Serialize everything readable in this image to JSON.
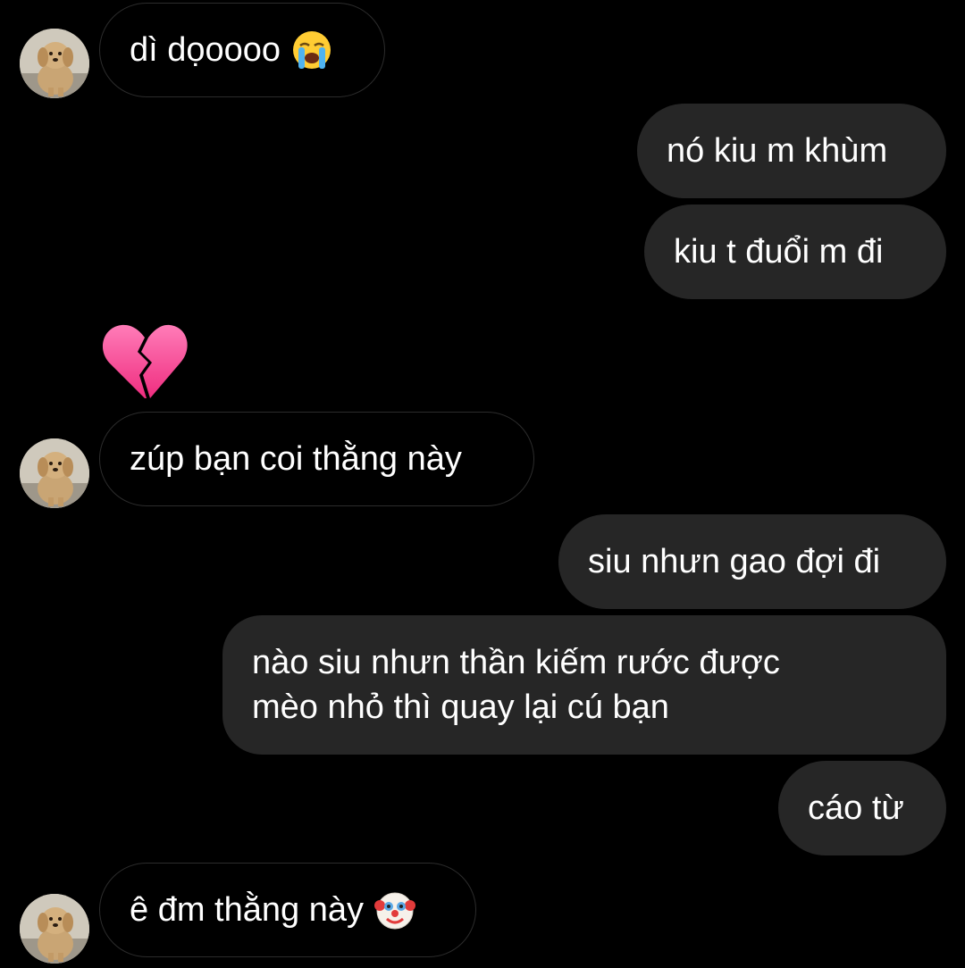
{
  "conversation": {
    "messages": [
      {
        "side": "in",
        "text": "dì dọoooo",
        "emoji": "loudly-crying-face"
      },
      {
        "side": "out",
        "text": "nó kiu m khùm"
      },
      {
        "side": "out",
        "text": "kiu t đuổi m đi"
      },
      {
        "side": "in",
        "text": "",
        "emoji": "broken-heart"
      },
      {
        "side": "in",
        "text": "zúp bạn coi thằng này"
      },
      {
        "side": "out",
        "text": "siu nhưn gao đợi đi"
      },
      {
        "side": "out",
        "text": "nào siu nhưn thần kiếm rước được\nmèo nhỏ thì quay lại cú bạn"
      },
      {
        "side": "out",
        "text": "cáo từ"
      },
      {
        "side": "in",
        "text": "ê đm thằng này",
        "emoji": "clown-face"
      }
    ]
  },
  "colors": {
    "background": "#000000",
    "outgoing_bubble": "#262626",
    "incoming_border": "#2c2c2c",
    "text": "#ffffff",
    "broken_heart": "#ff4f9a"
  }
}
